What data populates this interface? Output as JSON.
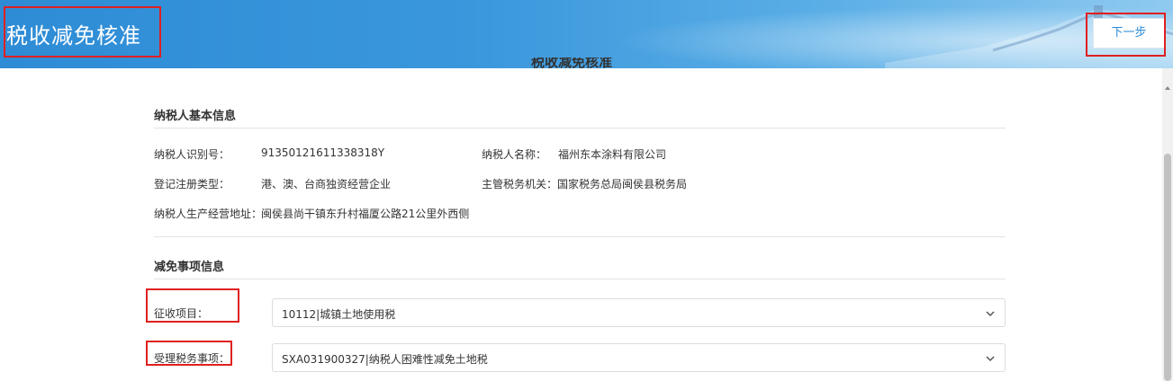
{
  "header": {
    "title": "税收减免核准",
    "next_button": "下一步",
    "partial_heading": "税收减免核准"
  },
  "taxpayer": {
    "section_title": "纳税人基本信息",
    "id_label": "纳税人识别号：",
    "id_value": "91350121611338318Y",
    "name_label": "纳税人名称：",
    "name_value": "福州东本涂料有限公司",
    "reg_type_label": "登记注册类型：",
    "reg_type_value": "港、澳、台商独资经营企业",
    "authority_label": "主管税务机关：",
    "authority_value": "国家税务总局闽侯县税务局",
    "address_label": "纳税人生产经营地址：",
    "address_value": "闽侯县尚干镇东升村福厦公路21公里外西侧"
  },
  "exemption": {
    "section_title": "减免事项信息",
    "levy_label": "征收项目：",
    "levy_value": "10112|城镇土地使用税",
    "matter_label": "受理税务事项：",
    "matter_value": "SXA031900327|纳税人困难性减免土地税"
  },
  "colors": {
    "header_blue": "#2e8cd6",
    "highlight_red": "#e02020"
  }
}
